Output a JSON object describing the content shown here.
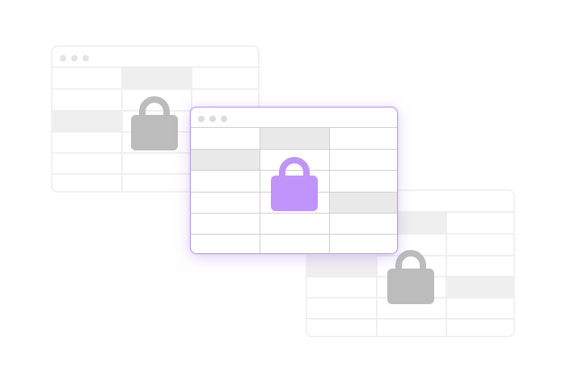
{
  "colors": {
    "active_border": "#b89cf7",
    "active_lock": "#bf94fb",
    "inactive_lock": "#bcbcbc",
    "grid_faded": "#efefef",
    "grid_active": "#cfcfcf",
    "shade_cell": "#e9e9e9"
  },
  "windows": [
    {
      "state": "inactive",
      "icon": "lock-icon"
    },
    {
      "state": "inactive",
      "icon": "lock-icon"
    },
    {
      "state": "active",
      "icon": "lock-icon"
    }
  ]
}
